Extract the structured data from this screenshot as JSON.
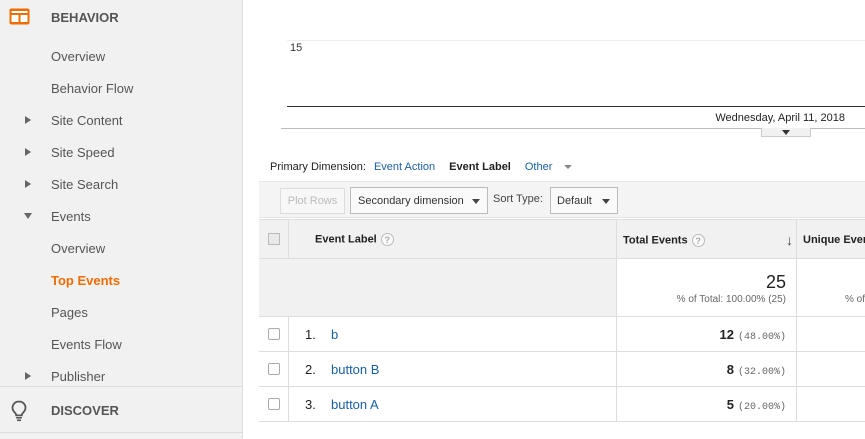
{
  "sidebar": {
    "behavior_title": "BEHAVIOR",
    "discover_title": "DISCOVER",
    "items": [
      {
        "label": "Overview"
      },
      {
        "label": "Behavior Flow"
      },
      {
        "label": "Site Content"
      },
      {
        "label": "Site Speed"
      },
      {
        "label": "Site Search"
      },
      {
        "label": "Events"
      },
      {
        "label": "Overview"
      },
      {
        "label": "Top Events"
      },
      {
        "label": "Pages"
      },
      {
        "label": "Events Flow"
      },
      {
        "label": "Publisher"
      }
    ],
    "accent_color": "#ef6c00"
  },
  "chart": {
    "y_tick": "15",
    "date_label": "Wednesday, April 11, 2018"
  },
  "dimension": {
    "label": "Primary Dimension:",
    "event_action": "Event Action",
    "event_label": "Event Label",
    "other": "Other"
  },
  "toolbar": {
    "plot_rows": "Plot Rows",
    "secondary_dimension": "Secondary dimension",
    "sort_type_label": "Sort Type:",
    "sort_type_value": "Default"
  },
  "table": {
    "headers": {
      "event_label": "Event Label",
      "total_events": "Total Events",
      "unique_events": "Unique Event"
    },
    "totals": {
      "total_events": "25",
      "total_events_pct": "% of Total: 100.00% (25)",
      "unique_events_pct": "% of"
    },
    "rows": [
      {
        "idx": "1.",
        "label": "b",
        "value": "12",
        "pct": "(48.00%)"
      },
      {
        "idx": "2.",
        "label": "button B",
        "value": "8",
        "pct": "(32.00%)"
      },
      {
        "idx": "3.",
        "label": "button A",
        "value": "5",
        "pct": "(20.00%)"
      }
    ]
  }
}
